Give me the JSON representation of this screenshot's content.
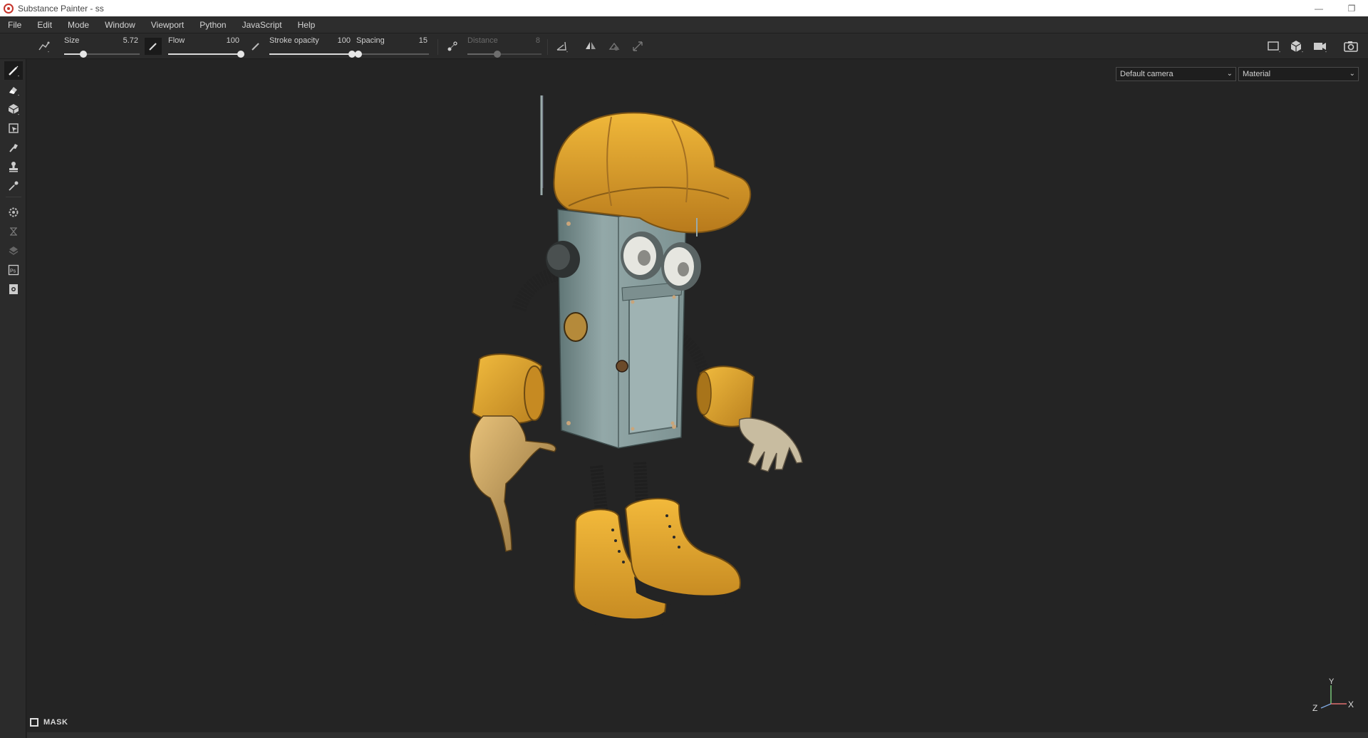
{
  "window": {
    "title": "Substance Painter - ss",
    "minimize": "—",
    "restore": "❐"
  },
  "menu": [
    "File",
    "Edit",
    "Mode",
    "Window",
    "Viewport",
    "Python",
    "JavaScript",
    "Help"
  ],
  "toolbar": {
    "size": {
      "label": "Size",
      "value": "5.72",
      "fraction": 0.25
    },
    "flow": {
      "label": "Flow",
      "value": "100",
      "fraction": 1.0
    },
    "stroke_opacity": {
      "label": "Stroke opacity",
      "value": "100",
      "fraction": 1.0
    },
    "spacing": {
      "label": "Spacing",
      "value": "15",
      "fraction": 0.03
    },
    "distance": {
      "label": "Distance",
      "value": "8",
      "fraction": 0.4,
      "disabled": true
    }
  },
  "sidebar_tools": [
    "paint-brush",
    "eraser",
    "projection",
    "polygon-fill",
    "smudge",
    "clone-stamp",
    "color-picker",
    "settings",
    "bake",
    "texture-set",
    "photoshop-export",
    "export"
  ],
  "viewport": {
    "camera_select": "Default camera",
    "mode_select": "Material",
    "mask_label": "MASK",
    "axis_labels": {
      "y": "Y",
      "z": "Z",
      "x": "X"
    }
  },
  "colors": {
    "yellow": "#e4a930",
    "metal_blue": "#8fa3a3",
    "background": "#242424"
  }
}
